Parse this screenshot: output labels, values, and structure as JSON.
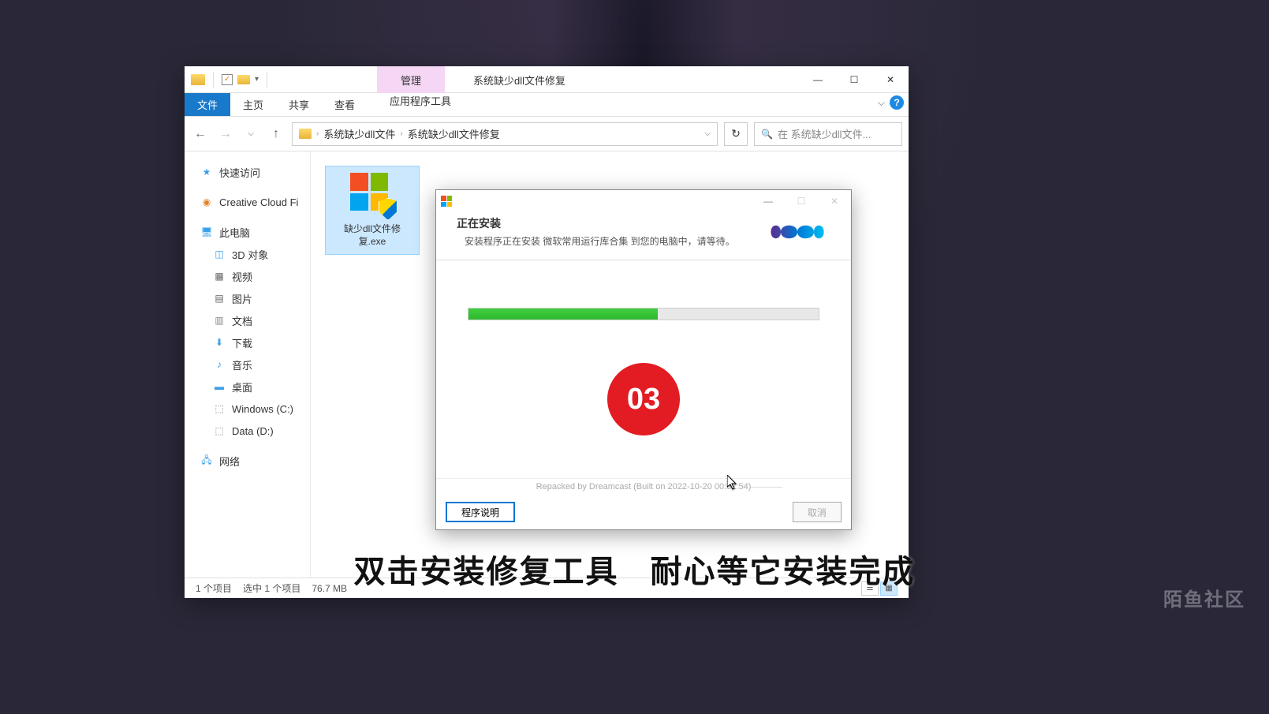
{
  "explorer": {
    "titleTab": "管理",
    "windowTitle": "系统缺少dll文件修复",
    "ribbonTabs": {
      "file": "文件",
      "home": "主页",
      "share": "共享",
      "view": "查看",
      "appTools": "应用程序工具"
    },
    "breadcrumb": {
      "seg1": "系统缺少dll文件",
      "seg2": "系统缺少dll文件修复"
    },
    "searchPlaceholder": "在 系统缺少dll文件...",
    "sidebar": {
      "quickAccess": "快速访问",
      "creativeCloud": "Creative Cloud Fi",
      "thisPC": "此电脑",
      "objects3d": "3D 对象",
      "videos": "视频",
      "pictures": "图片",
      "documents": "文档",
      "downloads": "下载",
      "music": "音乐",
      "desktop": "桌面",
      "driveC": "Windows (C:)",
      "driveD": "Data (D:)",
      "network": "网络"
    },
    "file": {
      "name": "缺少dll文件修复.exe"
    },
    "statusBar": {
      "items": "1 个项目",
      "selected": "选中 1 个项目",
      "size": "76.7 MB"
    }
  },
  "installer": {
    "title": "正在安装",
    "description": "安装程序正在安装 微软常用运行库合集 到您的电脑中，请等待。",
    "progressPercent": 54,
    "stepBadge": "03",
    "footerText": "Repacked by Dreamcast (Built on 2022-10-20 00:02:54)",
    "btnInfo": "程序说明",
    "btnCancel": "取消"
  },
  "subtitle": {
    "part1": "双击安装修复工具",
    "part2": "耐心等它安装完成"
  },
  "watermark": "陌鱼社区"
}
